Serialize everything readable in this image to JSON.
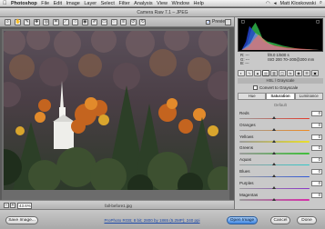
{
  "menubar": {
    "apple": "",
    "app_name": "Photoshop",
    "items": [
      "File",
      "Edit",
      "Image",
      "Layer",
      "Select",
      "Filter",
      "Analysis",
      "View",
      "Window",
      "Help"
    ],
    "user": "Matt Kloskowski"
  },
  "dialog": {
    "title": "Camera Raw 7.1  –  JPEG",
    "preview_label": "Preview",
    "preview_checked": true
  },
  "toolbar": {
    "tools": [
      {
        "icon": "zoom-icon",
        "glyph": "⌕"
      },
      {
        "icon": "hand-icon",
        "glyph": "✋"
      },
      {
        "icon": "white-balance-icon",
        "glyph": "✎"
      },
      {
        "icon": "color-sampler-icon",
        "glyph": "✚"
      },
      {
        "icon": "targeted-adjustment-icon",
        "glyph": "◎"
      },
      {
        "icon": "crop-icon",
        "glyph": "⌗"
      },
      {
        "icon": "straighten-icon",
        "glyph": "⟋"
      },
      {
        "icon": "spot-removal-icon",
        "glyph": "○"
      },
      {
        "icon": "red-eye-icon",
        "glyph": "◉"
      },
      {
        "icon": "adjustment-brush-icon",
        "glyph": "✐"
      },
      {
        "icon": "graduated-filter-icon",
        "glyph": "▭"
      },
      {
        "icon": "radial-filter-icon",
        "glyph": "◌"
      },
      {
        "icon": "preferences-icon",
        "glyph": "≡"
      },
      {
        "icon": "rotate-left-icon",
        "glyph": "↺"
      },
      {
        "icon": "rotate-right-icon",
        "glyph": "↻"
      }
    ]
  },
  "status": {
    "zoom_value": "43.6%",
    "filename": "fall-before1.jpg"
  },
  "bottom": {
    "save_image": "Save Image...",
    "workflow_link": "ProPhoto RGB; 8 bit; 2800 by 1865 (5.2MP); 240 ppi",
    "open_image": "Open Image",
    "cancel": "Cancel",
    "done": "Done"
  },
  "panel": {
    "rgb": [
      "R:  ---",
      "G:  ---",
      "B:  ---"
    ],
    "exif": [
      "f/8.0    1/500 s",
      "ISO 200    70–200@200 mm"
    ],
    "section_title": "HSL / Grayscale",
    "convert_label": "Convert to Grayscale",
    "subtabs": [
      "Hue",
      "Saturation",
      "Luminance"
    ],
    "active_subtab": 1,
    "default_label": "Default",
    "colors": {
      "accent": "#3f86e0"
    }
  },
  "sliders": [
    {
      "label": "Reds",
      "value": "0",
      "fraction": 0.5,
      "gradient": "linear-gradient(90deg,#9a9a9a,#e33a2a)"
    },
    {
      "label": "Oranges",
      "value": "0",
      "fraction": 0.5,
      "gradient": "linear-gradient(90deg,#9a9a9a,#f08a1f)"
    },
    {
      "label": "Yellows",
      "value": "0",
      "fraction": 0.5,
      "gradient": "linear-gradient(90deg,#9a9a9a,#eadf2a)"
    },
    {
      "label": "Greens",
      "value": "0",
      "fraction": 0.5,
      "gradient": "linear-gradient(90deg,#9a9a9a,#3fbf3a)"
    },
    {
      "label": "Aquas",
      "value": "0",
      "fraction": 0.5,
      "gradient": "linear-gradient(90deg,#9a9a9a,#2fc9c9)"
    },
    {
      "label": "Blues",
      "value": "0",
      "fraction": 0.5,
      "gradient": "linear-gradient(90deg,#9a9a9a,#2e57d9)"
    },
    {
      "label": "Purples",
      "value": "0",
      "fraction": 0.5,
      "gradient": "linear-gradient(90deg,#9a9a9a,#8a35c8)"
    },
    {
      "label": "Magentas",
      "value": "0",
      "fraction": 0.5,
      "gradient": "linear-gradient(90deg,#9a9a9a,#d52ea8)"
    }
  ]
}
